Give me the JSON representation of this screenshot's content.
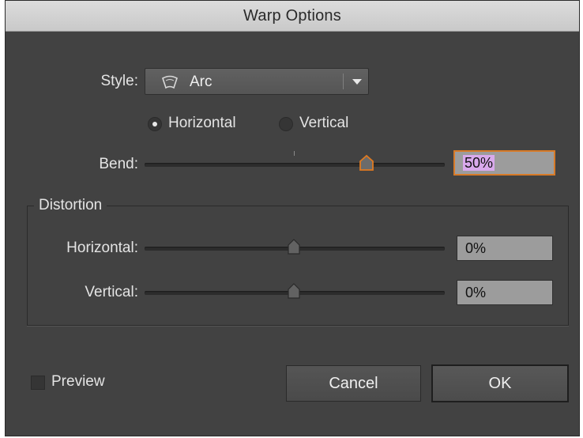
{
  "window": {
    "title": "Warp Options"
  },
  "style": {
    "label": "Style:",
    "value": "Arc",
    "icon": "arc-warp-icon"
  },
  "orientation": {
    "horizontal_label": "Horizontal",
    "vertical_label": "Vertical",
    "selected": "Horizontal"
  },
  "bend": {
    "label": "Bend:",
    "value": "50%",
    "level": 0.5
  },
  "distortion": {
    "title": "Distortion",
    "horizontal": {
      "label": "Horizontal:",
      "value": "0%",
      "level": 0
    },
    "vertical": {
      "label": "Vertical:",
      "value": "0%",
      "level": 0
    }
  },
  "preview": {
    "label": "Preview",
    "checked": false
  },
  "buttons": {
    "cancel": "Cancel",
    "ok": "OK"
  },
  "colors": {
    "dialog_bg": "#424242",
    "focus_accent": "#d77a28",
    "selection": "#d9a9ec"
  }
}
